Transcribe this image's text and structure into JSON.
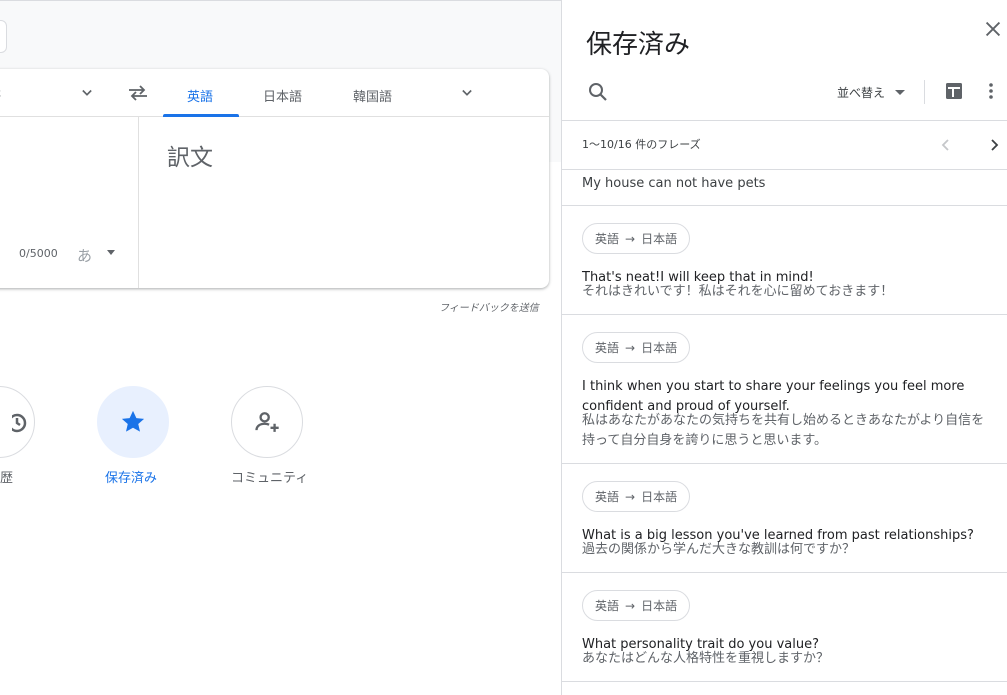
{
  "left": {
    "source_lang_partial": "語",
    "target_tabs": [
      {
        "label": "英語",
        "active": true
      },
      {
        "label": "日本語",
        "active": false
      },
      {
        "label": "韓国語",
        "active": false
      }
    ],
    "char_counter": "0/5000",
    "ime_label": "あ",
    "translation_placeholder": "訳文",
    "feedback_link": "フィードバックを送信",
    "shortcuts": [
      {
        "label": "歴",
        "icon": "history-icon",
        "active": false
      },
      {
        "label": "保存済み",
        "icon": "star-icon",
        "active": true
      },
      {
        "label": "コミュニティ",
        "icon": "community-icon",
        "active": false
      }
    ]
  },
  "panel": {
    "title": "保存済み",
    "sort_label": "並べ替え",
    "range_text": "1〜10/16 件のフレーズ",
    "first_phrase": "My house can not have pets",
    "entries": [
      {
        "src_lang": "英語",
        "arrow": "→",
        "tgt_lang": "日本語",
        "source": "That's neat!I will keep that in mind!",
        "target": "それはきれいです！私はそれを心に留めておきます！"
      },
      {
        "src_lang": "英語",
        "arrow": "→",
        "tgt_lang": "日本語",
        "source": "I think when you start to share your feelings you feel more confident and proud of yourself.",
        "target": "私はあなたがあなたの気持ちを共有し始めるときあなたがより自信を持って自分自身を誇りに思うと思います。"
      },
      {
        "src_lang": "英語",
        "arrow": "→",
        "tgt_lang": "日本語",
        "source": "What is a big lesson you've learned from past relationships?",
        "target": "過去の関係から学んだ大きな教訓は何ですか？"
      },
      {
        "src_lang": "英語",
        "arrow": "→",
        "tgt_lang": "日本語",
        "source": "What personality trait do you value?",
        "target": "あなたはどんな人格特性を重視しますか？"
      }
    ]
  },
  "colors": {
    "accent": "#1a73e8",
    "accent_light": "#e8f0fe",
    "text": "#3c4043",
    "muted": "#5f6368",
    "border": "#dadce0"
  }
}
